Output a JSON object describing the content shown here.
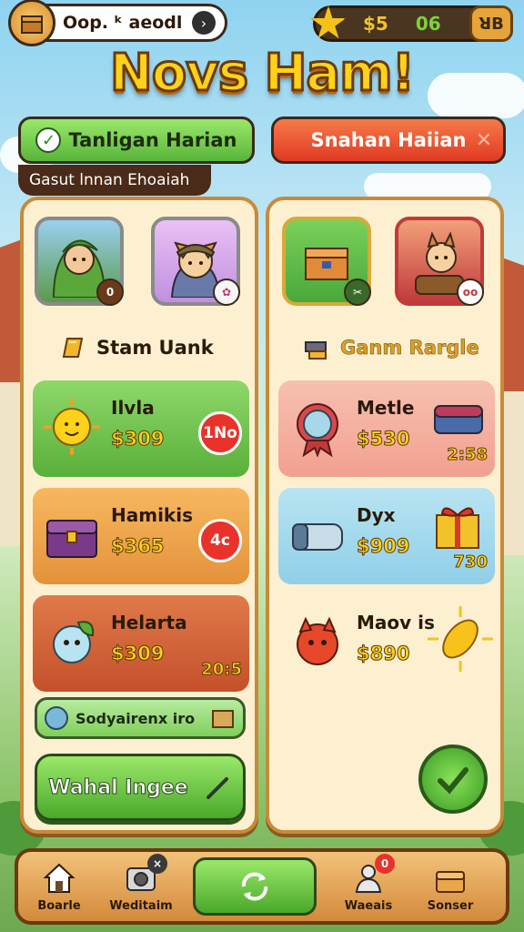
{
  "profile": {
    "name": "Oop. ᵏ aeodl",
    "arrow_icon": "arrow-right-icon"
  },
  "currency": {
    "coins": "$5",
    "gems": "06",
    "action_label": "ꓤB"
  },
  "title": "Novs Ham!",
  "tabs": [
    {
      "label": "Tanligan Harian",
      "icon": "check-icon"
    },
    {
      "label": "Snahan Haiian",
      "icon": "close-icon"
    }
  ],
  "subtitle": "Gasut lnnan Ehoaiah",
  "left_panel": {
    "portraits": [
      {
        "badge": "0"
      },
      {
        "badge": "✿"
      }
    ],
    "section_title": "Stam Uank",
    "items": [
      {
        "name": "Ilvla",
        "price": "$309",
        "badge": "1No"
      },
      {
        "name": "Hamikis",
        "price": "$365",
        "badge": "4c"
      },
      {
        "name": "Helarta",
        "price": "$309",
        "badge": "20:5"
      }
    ],
    "info_text": "Sodyairenx iro",
    "action_label": "Wahal Ingee"
  },
  "right_panel": {
    "portraits": [
      {
        "badge": "✂"
      },
      {
        "badge": "oo"
      }
    ],
    "section_title": "Ganm Rargle",
    "items": [
      {
        "name": "Metle",
        "price": "$530",
        "num": "2:58"
      },
      {
        "name": "Dyx",
        "price": "$909",
        "num": "730"
      },
      {
        "name": "Maov is",
        "price": "$890",
        "num": ""
      }
    ]
  },
  "nav": [
    {
      "label": "Boarle",
      "icon": "home-icon"
    },
    {
      "label": "Weditaim",
      "icon": "camera-icon",
      "badge": "×"
    },
    {
      "label": "",
      "icon": "refresh-icon"
    },
    {
      "label": "Waeais",
      "icon": "character-icon",
      "badge": "0"
    },
    {
      "label": "Sonser",
      "icon": "chest-icon"
    }
  ],
  "colors": {
    "accent_green": "#58b53a",
    "accent_red": "#e03a22",
    "gold": "#ffd21a",
    "panel": "#fdf0d0"
  }
}
